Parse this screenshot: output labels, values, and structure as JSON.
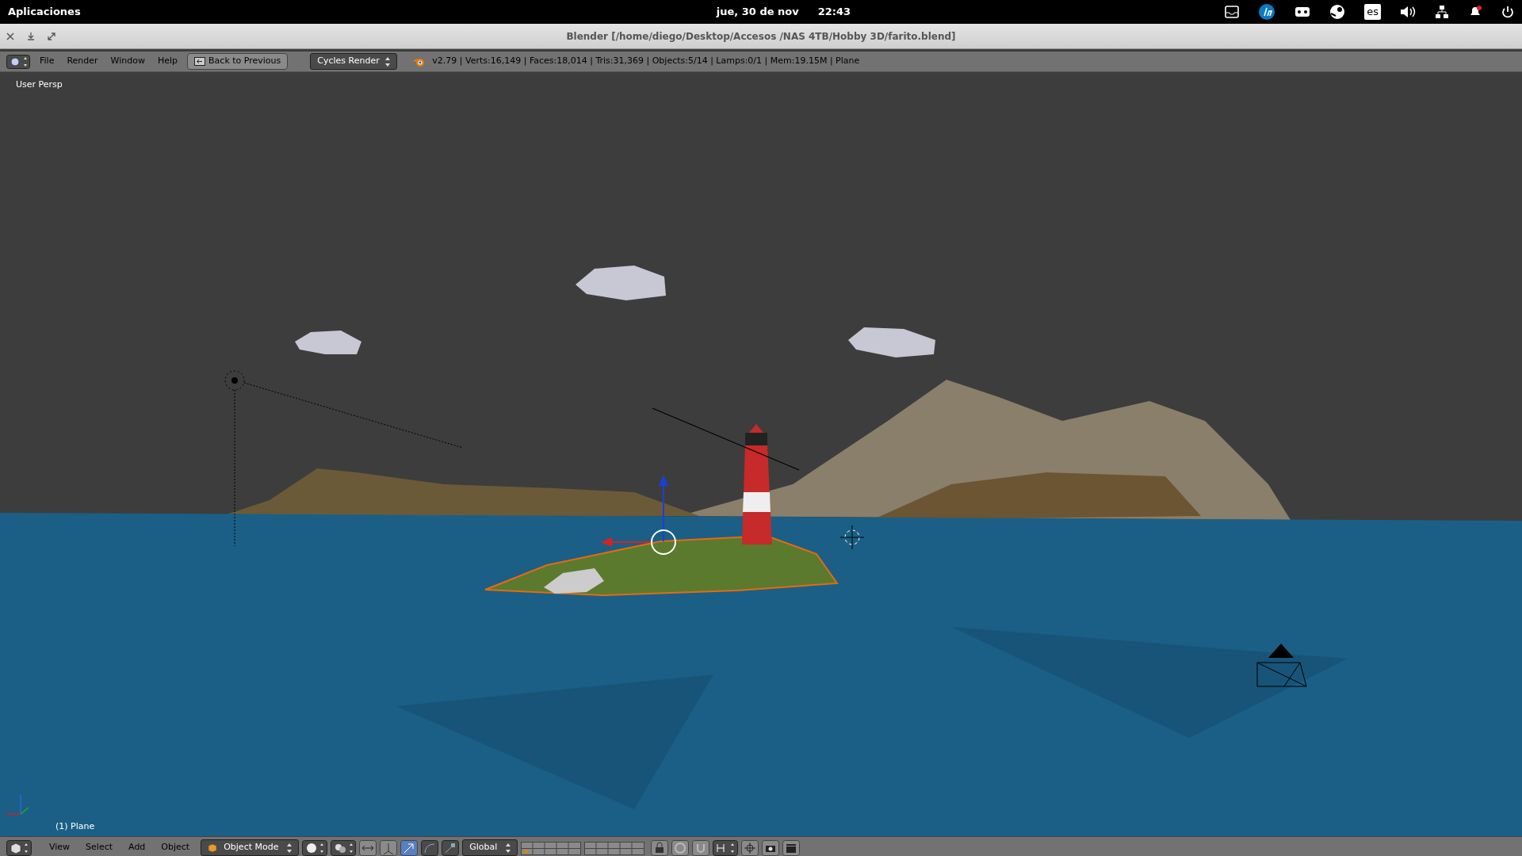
{
  "top_panel": {
    "apps_menu": "Aplicaciones",
    "date": "jue, 30 de nov",
    "time": "22:43",
    "keyboard_layout": "es"
  },
  "window": {
    "title": "Blender [/home/diego/Desktop/Accesos /NAS 4TB/Hobby 3D/farito.blend]"
  },
  "info_header": {
    "menus": [
      "File",
      "Render",
      "Window",
      "Help"
    ],
    "back_button": "Back to Previous",
    "render_engine": "Cycles Render",
    "stats": "v2.79 | Verts:16,149 | Faces:18,014 | Tris:31,369 | Objects:5/14 | Lamps:0/1 | Mem:19.15M | Plane"
  },
  "viewport": {
    "view_label": "User Persp",
    "object_label": "(1) Plane"
  },
  "view_header": {
    "menus": [
      "View",
      "Select",
      "Add",
      "Object"
    ],
    "mode": "Object Mode",
    "orientation": "Global"
  }
}
